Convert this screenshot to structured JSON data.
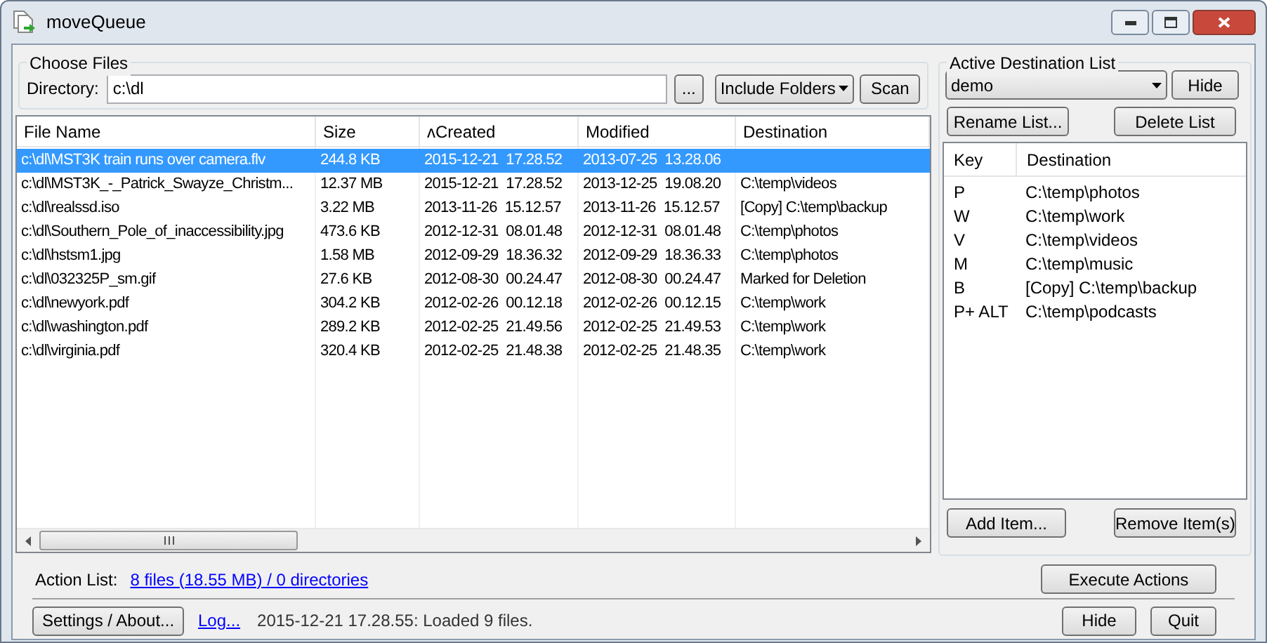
{
  "window": {
    "title": "moveQueue"
  },
  "choose_files": {
    "title": "Choose Files",
    "directory_label": "Directory:",
    "directory_value": "c:\\dl",
    "browse_button": "...",
    "filter_dropdown": "Include Folders",
    "scan_button": "Scan"
  },
  "table": {
    "columns": [
      "File Name",
      "Size",
      "ʌCreated",
      "Modified",
      "Destination"
    ],
    "rows": [
      {
        "cells": [
          "c:\\dl\\MST3K train runs over camera.flv",
          "244.8 KB",
          "2015-12-21  17.28.52",
          "2013-07-25  13.28.06",
          ""
        ],
        "selected": true
      },
      {
        "cells": [
          "c:\\dl\\MST3K_-_Patrick_Swayze_Christm...",
          "12.37 MB",
          "2015-12-21  17.28.52",
          "2013-12-25  19.08.20",
          "C:\\temp\\videos"
        ],
        "selected": false
      },
      {
        "cells": [
          "c:\\dl\\realssd.iso",
          "3.22 MB",
          "2013-11-26  15.12.57",
          "2013-11-26  15.12.57",
          "[Copy] C:\\temp\\backup"
        ],
        "selected": false
      },
      {
        "cells": [
          "c:\\dl\\Southern_Pole_of_inaccessibility.jpg",
          "473.6 KB",
          "2012-12-31  08.01.48",
          "2012-12-31  08.01.48",
          "C:\\temp\\photos"
        ],
        "selected": false
      },
      {
        "cells": [
          "c:\\dl\\hstsm1.jpg",
          "1.58 MB",
          "2012-09-29  18.36.32",
          "2012-09-29  18.36.33",
          "C:\\temp\\photos"
        ],
        "selected": false
      },
      {
        "cells": [
          "c:\\dl\\032325P_sm.gif",
          "27.6 KB",
          "2012-08-30  00.24.47",
          "2012-08-30  00.24.47",
          "Marked for Deletion"
        ],
        "selected": false
      },
      {
        "cells": [
          "c:\\dl\\newyork.pdf",
          "304.2 KB",
          "2012-02-26  00.12.18",
          "2012-02-26  00.12.15",
          "C:\\temp\\work"
        ],
        "selected": false
      },
      {
        "cells": [
          "c:\\dl\\washington.pdf",
          "289.2 KB",
          "2012-02-25  21.49.56",
          "2012-02-25  21.49.53",
          "C:\\temp\\work"
        ],
        "selected": false
      },
      {
        "cells": [
          "c:\\dl\\virginia.pdf",
          "320.4 KB",
          "2012-02-25  21.48.38",
          "2012-02-25  21.48.35",
          "C:\\temp\\work"
        ],
        "selected": false
      }
    ]
  },
  "destination_panel": {
    "title": "Active Destination List",
    "list_dropdown": "demo",
    "hide_button": "Hide",
    "rename_button": "Rename List...",
    "delete_button": "Delete List",
    "columns": [
      "Key",
      "Destination"
    ],
    "rows": [
      {
        "key": "P",
        "destination": "C:\\temp\\photos"
      },
      {
        "key": "W",
        "destination": "C:\\temp\\work"
      },
      {
        "key": "V",
        "destination": "C:\\temp\\videos"
      },
      {
        "key": "M",
        "destination": "C:\\temp\\music"
      },
      {
        "key": "B",
        "destination": "[Copy] C:\\temp\\backup"
      },
      {
        "key": "P+ ALT",
        "destination": "C:\\temp\\podcasts"
      }
    ],
    "add_button": "Add Item...",
    "remove_button": "Remove Item(s)"
  },
  "action_list": {
    "label": "Action List:",
    "link": "8 files (18.55 MB) / 0 directories",
    "execute_button": "Execute Actions"
  },
  "footer": {
    "settings_button": "Settings / About...",
    "log_link": "Log...",
    "status": "2015-12-21 17.28.55: Loaded 9 files.",
    "hide_button": "Hide",
    "quit_button": "Quit"
  }
}
